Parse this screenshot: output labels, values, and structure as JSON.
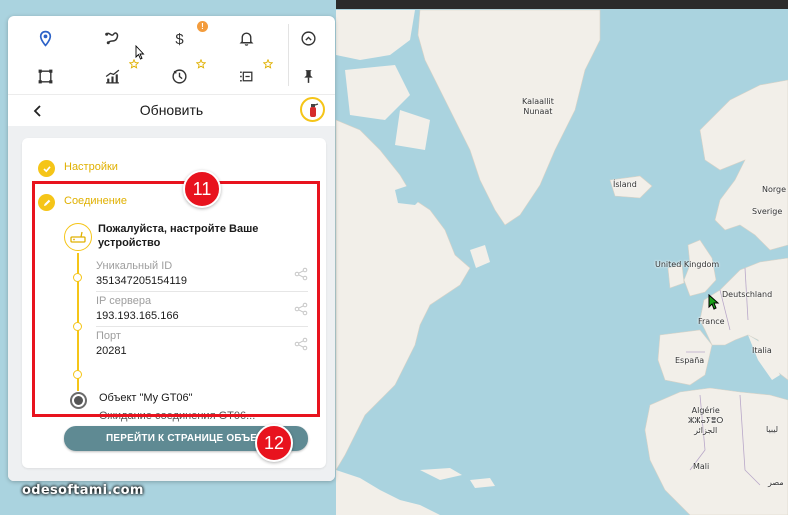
{
  "map": {
    "labels": {
      "kalaallit": "Kalaallit\nNunaat",
      "island": "Ísland",
      "norge": "Norge",
      "sverige": "Sverige",
      "uk": "United Kingdom",
      "deutschland": "Deutschland",
      "france": "France",
      "espana": "España",
      "italia": "Italia",
      "algerie": "Algérie\nⵣⵣⴰⵢⴻⵔ\nالجزائر",
      "mali": "Mali",
      "libya": "ليبيا",
      "egypt": "مصر"
    },
    "colors": {
      "water": "#aad3df",
      "land": "#f2efe9",
      "border": "#b9a8c9"
    }
  },
  "watermark": "odesoftami.com",
  "toolbar": {
    "notification_count": "!",
    "icons": [
      "map-pin-icon",
      "route-icon",
      "dollar-icon",
      "bell-icon",
      "chevron-up-circle-icon",
      "geofence-square-icon",
      "chart-icon",
      "history-icon",
      "tracker-list-icon",
      "pin-icon"
    ]
  },
  "header": {
    "title": "Обновить"
  },
  "steps": {
    "settings": "Настройки",
    "connection": "Соединение",
    "device_prompt": "Пожалуйста, настройте Ваше устройство"
  },
  "fields": [
    {
      "label": "Уникальный ID",
      "value": "351347205154119"
    },
    {
      "label": "IP сервера",
      "value": "193.193.165.166"
    },
    {
      "label": "Порт",
      "value": "20281"
    }
  ],
  "object": {
    "name": "Объект \"My GT06\"",
    "status": "Ожидание соединения GT06..."
  },
  "cta_label": "ПЕРЕЙТИ К СТРАНИЦЕ ОБЪЕКТА",
  "annotations": {
    "badge_1": "11",
    "badge_2": "12"
  },
  "accent_color": "#f5c518",
  "highlight_color": "#e8131e"
}
